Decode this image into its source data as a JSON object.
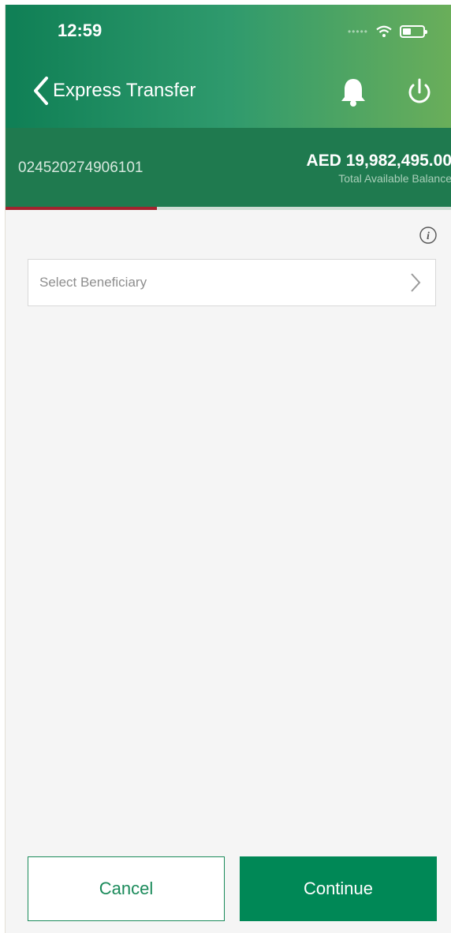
{
  "status_bar": {
    "time": "12:59",
    "signal_icon": "signal-dots-icon",
    "wifi_icon": "wifi-icon",
    "battery_icon": "battery-icon"
  },
  "nav": {
    "back_icon": "chevron-left-icon",
    "title": "Express Transfer",
    "notifications_icon": "bell-icon",
    "logout_icon": "power-icon"
  },
  "account": {
    "number": "024520274906101",
    "balance": "AED 19,982,495.00",
    "balance_label": "Total Available Balance"
  },
  "progress": {
    "completed_fraction": 0.34
  },
  "form": {
    "info_icon": "info-icon",
    "beneficiary_placeholder": "Select Beneficiary",
    "beneficiary_chevron_icon": "chevron-right-icon"
  },
  "actions": {
    "cancel_label": "Cancel",
    "continue_label": "Continue"
  },
  "colors": {
    "header_gradient_start": "#0f7f55",
    "header_gradient_end": "#6aae5a",
    "account_bar": "#1f7a4f",
    "progress_fill": "#a1242e",
    "primary_button": "#008856",
    "background": "#f5f5f5"
  }
}
